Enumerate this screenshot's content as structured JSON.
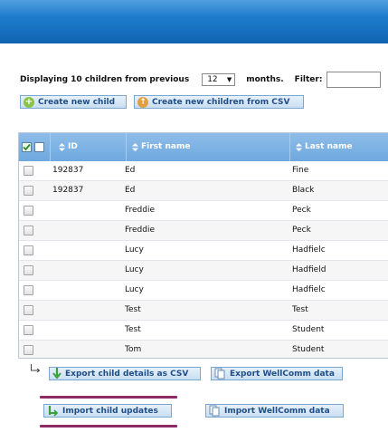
{
  "colors": {
    "header_blue": "#1a76c6",
    "grid_header": "#7fb3e4",
    "button_text": "#1f4e87",
    "highlight": "#8c2b66",
    "add_icon": "#8bc34a",
    "up_icon": "#e0a040",
    "export_icon": "#3aa13a"
  },
  "toolbar": {
    "display_prefix": "Displaying 10 children from previous",
    "months_value": "12",
    "months_suffix": "months.",
    "filter_label": "Filter:",
    "create_new_child": "Create new child",
    "create_from_csv": "Create new children from CSV"
  },
  "grid": {
    "columns": {
      "id": "ID",
      "first_name": "First name",
      "last_name": "Last name"
    },
    "rows": [
      {
        "id": "192837",
        "first": "Ed",
        "last": "Fine"
      },
      {
        "id": "192837",
        "first": "Ed",
        "last": "Black"
      },
      {
        "id": "",
        "first": "Freddie",
        "last": "Peck"
      },
      {
        "id": "",
        "first": "Freddie",
        "last": "Peck"
      },
      {
        "id": "",
        "first": "Lucy",
        "last": "Hadfielc"
      },
      {
        "id": "",
        "first": "Lucy",
        "last": "Hadfield"
      },
      {
        "id": "",
        "first": "Lucy",
        "last": "Hadfielc"
      },
      {
        "id": "",
        "first": "Test",
        "last": "Test"
      },
      {
        "id": "",
        "first": "Test",
        "last": "Student"
      },
      {
        "id": "",
        "first": "Tom",
        "last": "Student"
      }
    ],
    "export_child_details": "Export child details as CSV",
    "export_wellcomm": "Export WellComm data"
  },
  "actions": {
    "import_child_updates": "Import child updates",
    "import_wellcomm": "Import WellComm data"
  },
  "icons": {
    "add": "plus-circle-icon",
    "upload": "arrow-up-circle-icon",
    "export": "down-arrow-icon",
    "document": "document-icon",
    "import": "import-arrow-icon",
    "sort": "sort-icon",
    "select_all": "checkbox-icon"
  }
}
